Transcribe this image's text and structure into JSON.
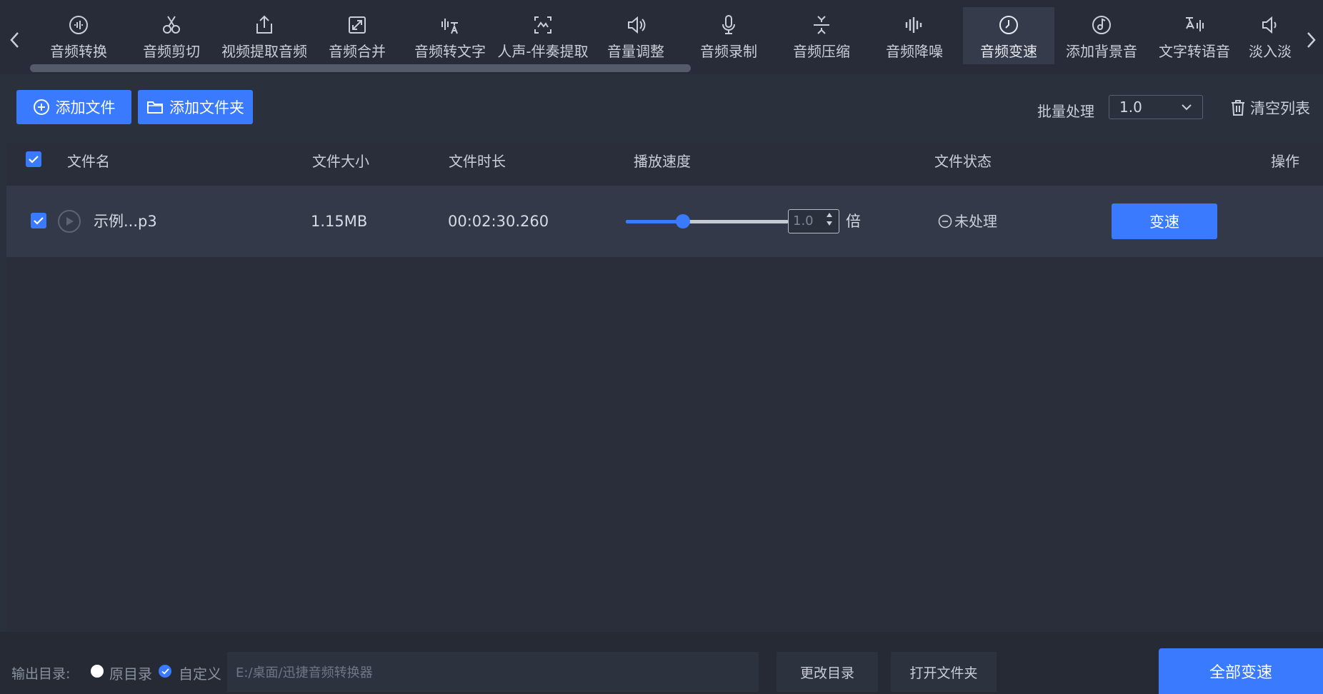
{
  "toolbar": {
    "tools": [
      {
        "label": "音频转换",
        "icon": "audio-wave-icon"
      },
      {
        "label": "音频剪切",
        "icon": "scissors-icon"
      },
      {
        "label": "视频提取音频",
        "icon": "upload-icon"
      },
      {
        "label": "音频合并",
        "icon": "merge-icon"
      },
      {
        "label": "音频转文字",
        "icon": "speech-to-text-icon"
      },
      {
        "label": "人声-伴奏提取",
        "icon": "voice-extract-icon"
      },
      {
        "label": "音量调整",
        "icon": "speaker-icon"
      },
      {
        "label": "音频录制",
        "icon": "microphone-icon"
      },
      {
        "label": "音频压缩",
        "icon": "compress-icon"
      },
      {
        "label": "音频降噪",
        "icon": "equalizer-icon"
      },
      {
        "label": "音频变速",
        "icon": "clock-icon",
        "active": true
      },
      {
        "label": "添加背景音",
        "icon": "music-disc-icon"
      },
      {
        "label": "文字转语音",
        "icon": "text-to-speech-icon"
      },
      {
        "label": "淡入淡",
        "icon": "fade-icon"
      }
    ]
  },
  "actions": {
    "add_file": "添加文件",
    "add_folder": "添加文件夹",
    "batch_label": "批量处理",
    "batch_value": "1.0",
    "clear_list": "清空列表"
  },
  "table": {
    "headers": {
      "name": "文件名",
      "size": "文件大小",
      "duration": "文件时长",
      "speed": "播放速度",
      "status": "文件状态",
      "action": "操作"
    },
    "rows": [
      {
        "name": "示例...p3",
        "size": "1.15MB",
        "duration": "00:02:30.260",
        "speed_value": "1.0",
        "speed_unit": "倍",
        "slider_fraction": 0.35,
        "status": "未处理",
        "action": "变速"
      }
    ]
  },
  "footer": {
    "output_label": "输出目录:",
    "option_original": "原目录",
    "option_custom": "自定义",
    "path": "E:/桌面/迅捷音频转换器",
    "change_dir": "更改目录",
    "open_folder": "打开文件夹",
    "process_all": "全部变速"
  },
  "colors": {
    "accent": "#3a7afe",
    "background": "#2b303d",
    "row": "#333948"
  }
}
